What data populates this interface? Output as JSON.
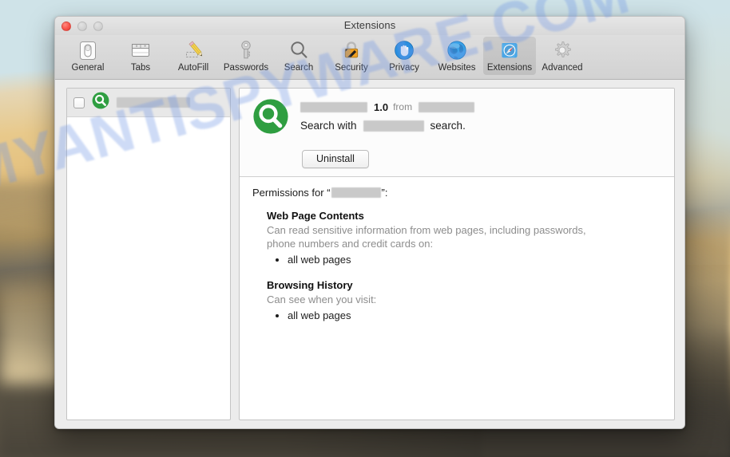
{
  "window": {
    "title": "Extensions",
    "traffic_lights": [
      "close",
      "minimize",
      "zoom"
    ]
  },
  "toolbar": {
    "items": [
      {
        "label": "General",
        "icon": "general-switch-icon",
        "selected": false
      },
      {
        "label": "Tabs",
        "icon": "tabs-window-icon",
        "selected": false
      },
      {
        "label": "AutoFill",
        "icon": "autofill-pencil-icon",
        "selected": false
      },
      {
        "label": "Passwords",
        "icon": "key-icon",
        "selected": false
      },
      {
        "label": "Search",
        "icon": "magnifier-icon",
        "selected": false
      },
      {
        "label": "Security",
        "icon": "padlock-icon",
        "selected": false
      },
      {
        "label": "Privacy",
        "icon": "hand-icon",
        "selected": false
      },
      {
        "label": "Websites",
        "icon": "globe-icon",
        "selected": false
      },
      {
        "label": "Extensions",
        "icon": "puzzle-compass-icon",
        "selected": true
      },
      {
        "label": "Advanced",
        "icon": "gear-icon",
        "selected": false
      }
    ]
  },
  "sidebar": {
    "rows": [
      {
        "checked": false,
        "icon": "green-magnifier-extension-icon",
        "name_redacted": true,
        "name": ""
      }
    ]
  },
  "detail": {
    "icon": "green-magnifier-extension-icon",
    "name_redacted": true,
    "name": "",
    "version": "1.0",
    "from_label": "from",
    "vendor_redacted": true,
    "vendor": "",
    "description_prefix": "Search with",
    "description_redacted": true,
    "description_engine": "",
    "description_suffix": "search.",
    "uninstall_label": "Uninstall"
  },
  "permissions": {
    "title_prefix": "Permissions for “",
    "title_name_redacted": true,
    "title_name": "",
    "title_suffix": "”:",
    "groups": [
      {
        "heading": "Web Page Contents",
        "description": "Can read sensitive information from web pages, including passwords, phone numbers and credit cards on:",
        "items": [
          "all web pages"
        ]
      },
      {
        "heading": "Browsing History",
        "description": "Can see when you visit:",
        "items": [
          "all web pages"
        ]
      }
    ]
  },
  "watermark": {
    "text": "MYANTISPYWARE.COM",
    "color": "#6e96e4"
  },
  "colors": {
    "window_chrome": "#ececec",
    "toolbar_top": "#dedede",
    "selected_row": "#e8e8e8",
    "extension_green": "#2f9e41",
    "redaction_gray": "#c9c9c9",
    "muted_text": "#8d8d8d"
  }
}
